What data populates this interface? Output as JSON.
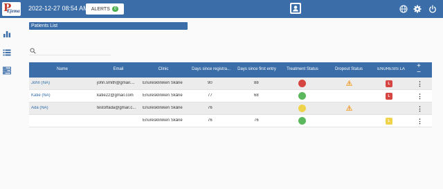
{
  "header": {
    "logo_text": "Ejema",
    "datetime": "2022-12-27 08:54 AM",
    "alerts_label": "ALERTS",
    "alerts_count": "0"
  },
  "page": {
    "title": "Patients List",
    "search_placeholder": ""
  },
  "table": {
    "columns": [
      "Name",
      "Email",
      "Clinic",
      "Days since registra...",
      "Days since first entry",
      "Treatment Status",
      "Dropout Status",
      "ENURESIS LA"
    ],
    "add_label": "+",
    "remove_label": "−",
    "rows": [
      {
        "name": "John (NA)",
        "email": "john.smith@gmail....",
        "clinic": "Enureskliniken Skåne",
        "days_reg": "90",
        "days_first": "88",
        "treatment": "red",
        "dropout": "warn",
        "enuresis": "L",
        "enuresis_color": "red"
      },
      {
        "name": "Katie (NA)",
        "email": "katie22@gmail.com",
        "clinic": "Enureskliniken Skåne",
        "days_reg": "77",
        "days_first": "68",
        "treatment": "green",
        "dropout": "",
        "enuresis": "L",
        "enuresis_color": "red"
      },
      {
        "name": "Ada (NA)",
        "email": "testoffada@gmail.c...",
        "clinic": "Enureskliniken Skåne",
        "days_reg": "76",
        "days_first": "",
        "treatment": "yellow",
        "dropout": "warn",
        "enuresis": "",
        "enuresis_color": ""
      },
      {
        "name": "",
        "email": "",
        "clinic": "Enureskliniken Skåne",
        "days_reg": "76",
        "days_first": "76",
        "treatment": "green",
        "dropout": "",
        "enuresis": "L",
        "enuresis_color": "yellow"
      }
    ]
  },
  "colors": {
    "primary": "#3b6ea8",
    "status_red": "#d64541",
    "status_green": "#5cb85c",
    "status_yellow": "#f0d34a",
    "warn_orange": "#f0a030"
  }
}
